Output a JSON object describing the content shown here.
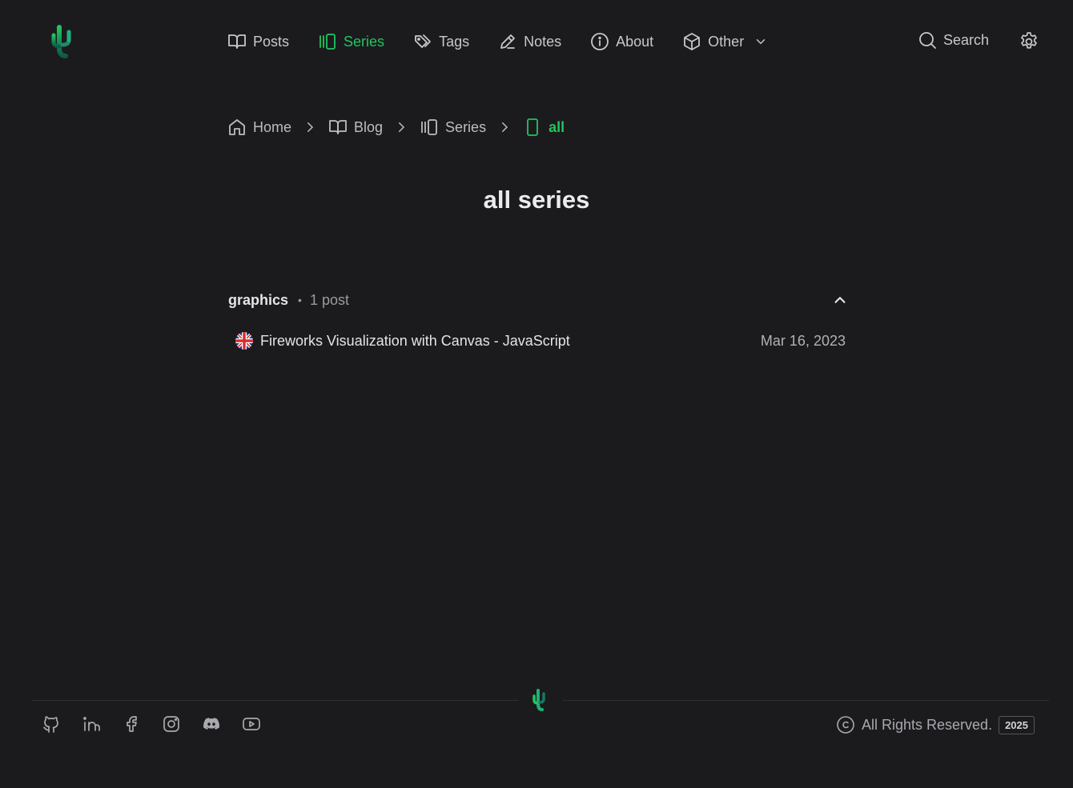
{
  "header": {
    "nav": [
      {
        "label": "Posts",
        "icon": "book-open-icon",
        "active": false
      },
      {
        "label": "Series",
        "icon": "columns-icon",
        "active": true
      },
      {
        "label": "Tags",
        "icon": "tags-icon",
        "active": false
      },
      {
        "label": "Notes",
        "icon": "pencil-icon",
        "active": false
      },
      {
        "label": "About",
        "icon": "info-icon",
        "active": false
      },
      {
        "label": "Other",
        "icon": "box-icon",
        "active": false
      }
    ],
    "search_label": "Search"
  },
  "breadcrumb": [
    {
      "label": "Home",
      "icon": "home-icon"
    },
    {
      "label": "Blog",
      "icon": "book-open-icon"
    },
    {
      "label": "Series",
      "icon": "columns-icon"
    },
    {
      "label": "all",
      "icon": "rectangle-icon",
      "current": true
    }
  ],
  "page_title": "all series",
  "groups": [
    {
      "name": "graphics",
      "separator": "•",
      "count_label": "1 post",
      "expanded": true,
      "posts": [
        {
          "title": "Fireworks Visualization with Canvas - JavaScript",
          "date": "Mar 16, 2023",
          "language_icon": "uk-flag-icon"
        }
      ]
    }
  ],
  "footer": {
    "socials": [
      "github-icon",
      "linkedin-icon",
      "facebook-icon",
      "instagram-icon",
      "discord-icon",
      "youtube-icon"
    ],
    "copyright_text": "All Rights Reserved.",
    "year": "2025"
  },
  "colors": {
    "background": "#1b1b1e",
    "accent": "#22c55e",
    "text": "#d4d4d8"
  }
}
